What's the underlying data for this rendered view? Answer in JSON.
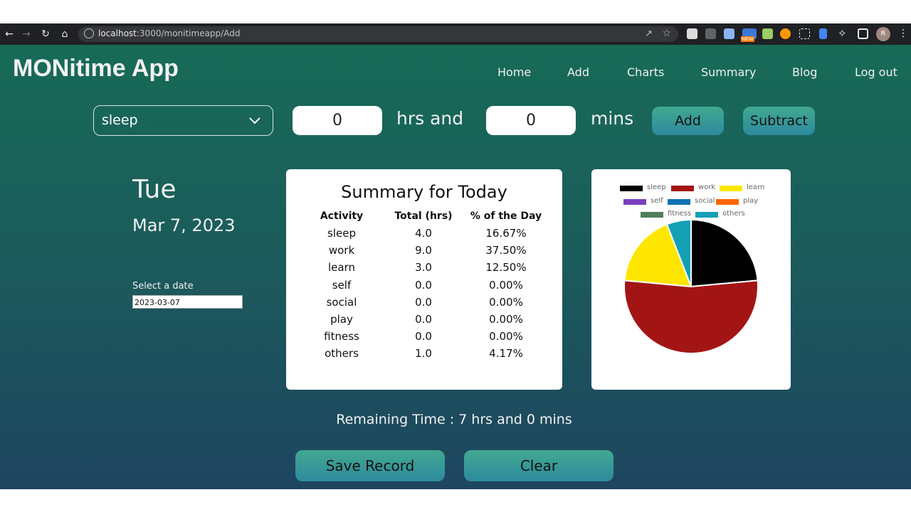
{
  "browser": {
    "url_host": "localhost",
    "url_path": ":3000/monitimeapp/Add",
    "avatar_letter": "R",
    "ext_badge": "NEW"
  },
  "brand": "MONitime App",
  "nav": [
    "Home",
    "Add",
    "Charts",
    "Summary",
    "Blog",
    "Log out"
  ],
  "form": {
    "activity_selected": "sleep",
    "hours_value": "0",
    "hours_label": "hrs and",
    "mins_value": "0",
    "mins_label": "mins",
    "add_label": "Add",
    "subtract_label": "Subtract"
  },
  "date_panel": {
    "weekday": "Tue",
    "date": "Mar 7, 2023",
    "select_label": "Select a date",
    "date_value": "2023-03-07"
  },
  "summary": {
    "title": "Summary for Today",
    "headers": [
      "Activity",
      "Total (hrs)",
      "% of the Day"
    ],
    "rows": [
      [
        "sleep",
        "4.0",
        "16.67%"
      ],
      [
        "work",
        "9.0",
        "37.50%"
      ],
      [
        "learn",
        "3.0",
        "12.50%"
      ],
      [
        "self",
        "0.0",
        "0.00%"
      ],
      [
        "social",
        "0.0",
        "0.00%"
      ],
      [
        "play",
        "0.0",
        "0.00%"
      ],
      [
        "fitness",
        "0.0",
        "0.00%"
      ],
      [
        "others",
        "1.0",
        "4.17%"
      ]
    ]
  },
  "chart_data": {
    "type": "pie",
    "categories": [
      "sleep",
      "work",
      "learn",
      "self",
      "social",
      "play",
      "fitness",
      "others"
    ],
    "values": [
      4.0,
      9.0,
      3.0,
      0.0,
      0.0,
      0.0,
      0.0,
      1.0
    ],
    "colors": [
      "#000000",
      "#a31515",
      "#ffe600",
      "#7b3fbf",
      "#0f72b5",
      "#ff6600",
      "#4f7f5a",
      "#13a0b5"
    ],
    "legend_position": "top"
  },
  "remaining": "Remaining Time : 7 hrs and 0 mins",
  "buttons": {
    "save_label": "Save Record",
    "clear_label": "Clear"
  }
}
